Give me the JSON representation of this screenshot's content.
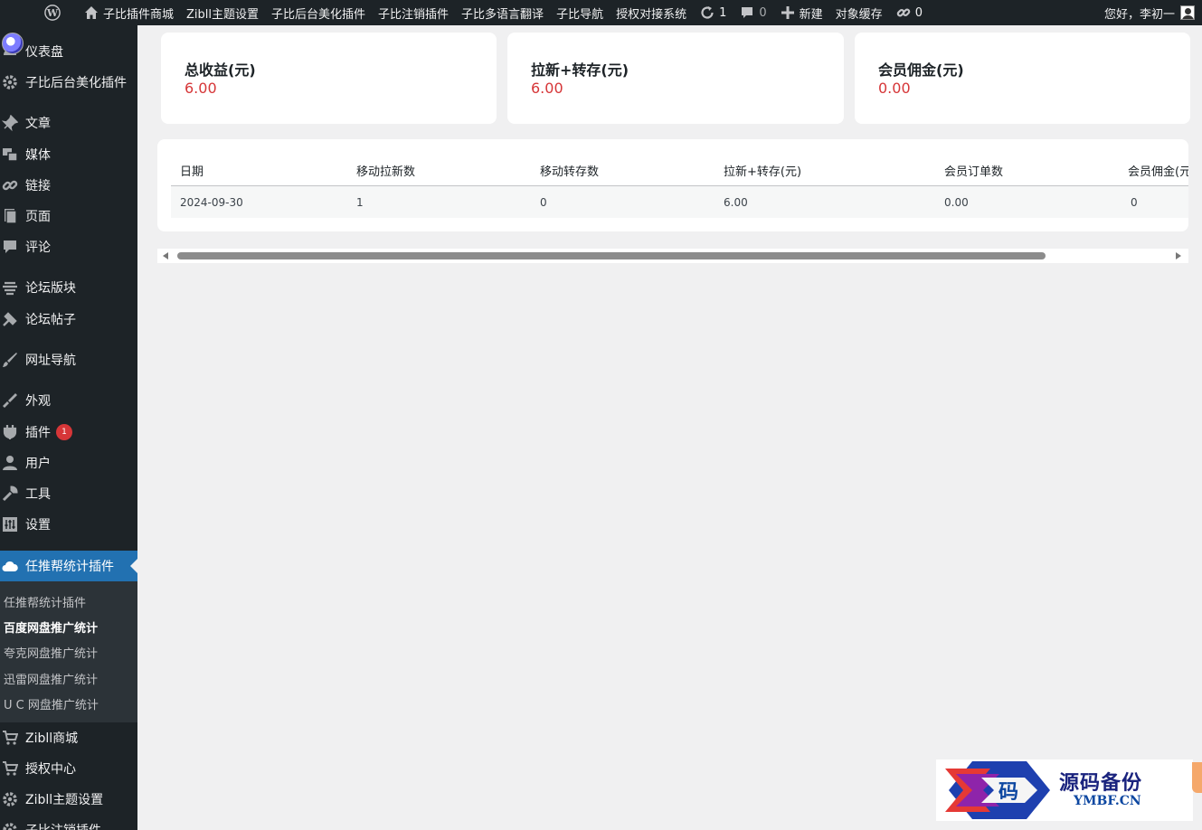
{
  "adminbar": {
    "items": [
      {
        "label": "子比插件商城",
        "icon": "home-icon"
      },
      {
        "label": "Zibll主题设置"
      },
      {
        "label": "子比后台美化插件"
      },
      {
        "label": "子比注销插件"
      },
      {
        "label": "子比多语言翻译"
      },
      {
        "label": "子比导航"
      },
      {
        "label": "授权对接系统"
      }
    ],
    "updates_count": "1",
    "comments_count": "0",
    "new_label": "新建",
    "cache_label": "对象缓存",
    "links_count": "0",
    "greeting": "您好，李初一"
  },
  "sidebar": {
    "items": [
      {
        "label": "仪表盘",
        "icon": "dashboard-icon"
      },
      {
        "label": "子比后台美化插件",
        "icon": "gear-icon"
      },
      {
        "label": "文章",
        "icon": "pin-icon"
      },
      {
        "label": "媒体",
        "icon": "media-icon"
      },
      {
        "label": "链接",
        "icon": "link-icon"
      },
      {
        "label": "页面",
        "icon": "page-icon"
      },
      {
        "label": "评论",
        "icon": "comment-icon"
      },
      {
        "label": "论坛版块",
        "icon": "forum-icon"
      },
      {
        "label": "论坛帖子",
        "icon": "hammer-icon"
      },
      {
        "label": "网址导航",
        "icon": "brush-icon"
      },
      {
        "label": "外观",
        "icon": "appearance-icon"
      },
      {
        "label": "插件",
        "icon": "plugin-icon",
        "badge": "1"
      },
      {
        "label": "用户",
        "icon": "user-icon"
      },
      {
        "label": "工具",
        "icon": "wrench-icon"
      },
      {
        "label": "设置",
        "icon": "settings-icon"
      },
      {
        "label": "任推帮统计插件",
        "icon": "cloud-icon"
      },
      {
        "label": "Zibll商城",
        "icon": "cart-icon"
      },
      {
        "label": "授权中心",
        "icon": "cart-icon"
      },
      {
        "label": "Zibll主题设置",
        "icon": "gear-icon"
      },
      {
        "label": "子比注销插件",
        "icon": "gear-icon"
      }
    ],
    "submenu": [
      {
        "label": "任推帮统计插件"
      },
      {
        "label": "百度网盘推广统计"
      },
      {
        "label": "夸克网盘推广统计"
      },
      {
        "label": "迅雷网盘推广统计"
      },
      {
        "label": "U C 网盘推广统计"
      }
    ]
  },
  "cards": [
    {
      "title": "总收益(元)",
      "value": "6.00"
    },
    {
      "title": "拉新+转存(元)",
      "value": "6.00"
    },
    {
      "title": "会员佣金(元)",
      "value": "0.00"
    }
  ],
  "table": {
    "headers": [
      "日期",
      "移动拉新数",
      "移动转存数",
      "拉新+转存(元)",
      "会员订单数",
      "会员佣金(元)"
    ],
    "rows": [
      [
        "2024-09-30",
        "1",
        "0",
        "6.00",
        "0.00",
        "0"
      ]
    ]
  },
  "watermark": {
    "cn": "源码备份",
    "en": "YMBF.CN",
    "glyph": "码"
  },
  "colors": {
    "accent": "#2271b1",
    "value_red": "#d63638",
    "sidebar": "#1d2327"
  }
}
